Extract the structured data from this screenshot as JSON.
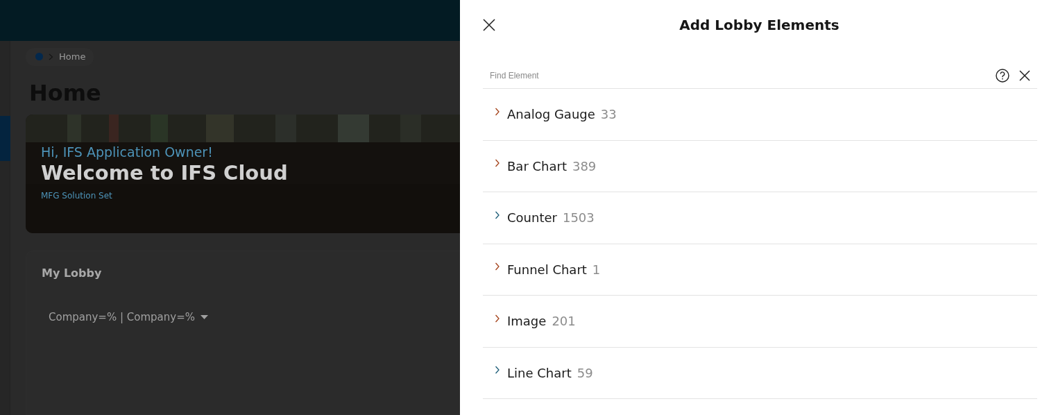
{
  "background_page": {
    "breadcrumb": {
      "items": [
        "Home"
      ]
    },
    "title": "Home",
    "hero": {
      "greeting": "Hi, IFS Application Owner!",
      "headline": "Welcome to IFS Cloud",
      "subtitle": "MFG Solution Set"
    },
    "lobby": {
      "title": "My Lobby",
      "filter": "Company=% | Company=%"
    }
  },
  "panel": {
    "title": "Add Lobby Elements",
    "search": {
      "placeholder": "Find Element"
    },
    "items": [
      {
        "label": "Analog Gauge",
        "count": "33",
        "expanded": false,
        "color": "#a4421a"
      },
      {
        "label": "Bar Chart",
        "count": "389",
        "expanded": false,
        "color": "#a4421a"
      },
      {
        "label": "Counter",
        "count": "1503",
        "expanded": false,
        "color": "#1d5d78"
      },
      {
        "label": "Funnel Chart",
        "count": "1",
        "expanded": false,
        "color": "#a4421a"
      },
      {
        "label": "Image",
        "count": "201",
        "expanded": false,
        "color": "#a4421a"
      },
      {
        "label": "Line Chart",
        "count": "59",
        "expanded": false,
        "color": "#1d5d78"
      }
    ]
  }
}
